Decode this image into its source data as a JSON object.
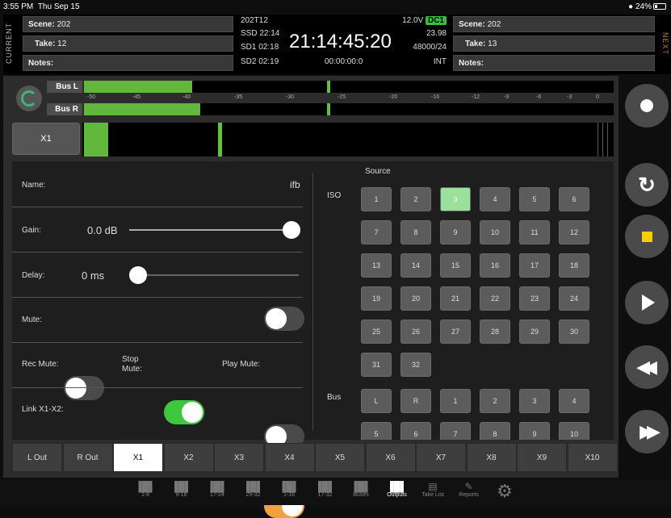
{
  "status": {
    "time": "3:55 PM",
    "date": "Thu Sep 15",
    "battery": "24%"
  },
  "current": {
    "side_label": "CURRENT",
    "scene_label": "Scene:",
    "scene": "202",
    "take_label": "Take:",
    "take": "12",
    "notes_label": "Notes:"
  },
  "next": {
    "side_label": "NEXT",
    "scene_label": "Scene:",
    "scene": "202",
    "take_label": "Take:",
    "take": "13",
    "notes_label": "Notes:"
  },
  "center": {
    "project": "202T12",
    "voltage": "12.0V",
    "power_source": "DC1",
    "ssd": "SSD 22:14",
    "sd1": "SD1 02:18",
    "sd2": "SD2 02:19",
    "timecode": "21:14:45:20",
    "fps": "23.98",
    "rate": "48000/24",
    "counter": "00:00:00:0",
    "tc_source": "INT"
  },
  "meters": {
    "bus_l": "Bus L",
    "bus_r": "Bus R",
    "scale": [
      "-50",
      "-45",
      "-40",
      "-35",
      "-30",
      "-25",
      "-20",
      "-16",
      "-12",
      "-9",
      "-6",
      "-3",
      "0"
    ],
    "x1": "X1"
  },
  "settings": {
    "name_label": "Name:",
    "name_value": "ifb",
    "gain_label": "Gain:",
    "gain_value": "0.0 dB",
    "delay_label": "Delay:",
    "delay_value": "0 ms",
    "mute_label": "Mute:",
    "rec_mute_label": "Rec Mute:",
    "stop_mute_label": "Stop\nMute:",
    "play_mute_label": "Play Mute:",
    "link_label": "Link X1-X2:"
  },
  "source": {
    "title": "Source",
    "iso_label": "ISO",
    "iso": [
      "1",
      "2",
      "3",
      "4",
      "5",
      "6",
      "7",
      "8",
      "9",
      "10",
      "11",
      "12",
      "13",
      "14",
      "15",
      "16",
      "17",
      "18",
      "19",
      "20",
      "21",
      "22",
      "23",
      "24",
      "25",
      "26",
      "27",
      "28",
      "29",
      "30",
      "31",
      "32"
    ],
    "iso_selected": "3",
    "bus_label": "Bus",
    "bus": [
      "L",
      "R",
      "1",
      "2",
      "3",
      "4",
      "5",
      "6",
      "7",
      "8",
      "9",
      "10"
    ]
  },
  "tabs": [
    "L Out",
    "R Out",
    "X1",
    "X2",
    "X3",
    "X4",
    "X5",
    "X6",
    "X7",
    "X8",
    "X9",
    "X10"
  ],
  "tab_selected": "X1",
  "toolbar": [
    {
      "label": "1-8",
      "icon": "meter-icon"
    },
    {
      "label": "9-16",
      "icon": "meter-icon"
    },
    {
      "label": "17-24",
      "icon": "meter-icon"
    },
    {
      "label": "25-32",
      "icon": "meter-icon"
    },
    {
      "label": "1-16",
      "icon": "meter-icon"
    },
    {
      "label": "17-32",
      "icon": "meter-icon"
    },
    {
      "label": "Buses",
      "icon": "meter-icon"
    },
    {
      "label": "Outputs",
      "icon": "meter-icon"
    },
    {
      "label": "Take List",
      "icon": "clapper-icon"
    },
    {
      "label": "Reports",
      "icon": "report-icon"
    },
    {
      "label": "",
      "icon": "gear-icon"
    }
  ],
  "colors": {
    "meter": "#62b83d",
    "select": "#9ae29b",
    "toggle_on": "#3ec63e",
    "link_on": "#f0a03c",
    "stop": "#f5d000"
  }
}
